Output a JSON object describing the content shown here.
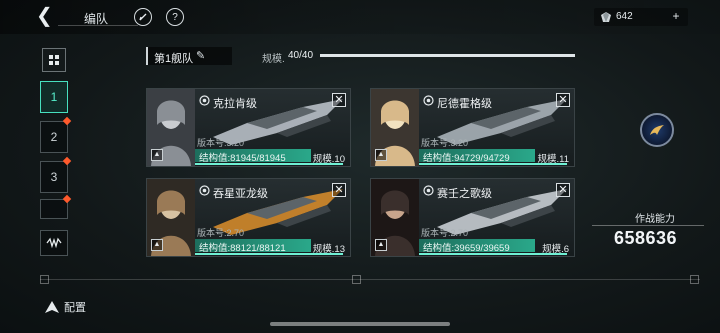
{
  "header": {
    "title": "编队",
    "currency_value": "642"
  },
  "sidebar": {
    "tabs": [
      {
        "label": "1",
        "active": true
      },
      {
        "label": "2",
        "active": false
      },
      {
        "label": "3",
        "active": false
      },
      {
        "label": "",
        "active": false
      }
    ]
  },
  "fleet": {
    "name": "第1舰队",
    "scale_label": "规模.",
    "scale_value": "40/40",
    "scale_fraction": 1.0
  },
  "ships": [
    {
      "name": "克拉肯级",
      "version": "版本号:3.20",
      "structure": "结构值:81945/81945",
      "structure_fraction": 1.0,
      "scale": "规模.10"
    },
    {
      "name": "尼德霍格级",
      "version": "版本号:3.20",
      "structure": "结构值:94729/94729",
      "structure_fraction": 1.0,
      "scale": "规模.11"
    },
    {
      "name": "吞星亚龙级",
      "version": "版本号:2.70",
      "structure": "结构值:88121/88121",
      "structure_fraction": 1.0,
      "scale": "规模.13"
    },
    {
      "name": "赛壬之歌级",
      "version": "版本号:2.70",
      "structure": "结构值:39659/39659",
      "structure_fraction": 1.0,
      "scale": "规模.6"
    }
  ],
  "power": {
    "label": "作战能力",
    "value": "658636"
  },
  "bottom": {
    "config_label": "配置"
  },
  "colors": {
    "accent": "#47e0bf",
    "structure_bar": "#2aa88a",
    "alert": "#ff5a2c"
  }
}
